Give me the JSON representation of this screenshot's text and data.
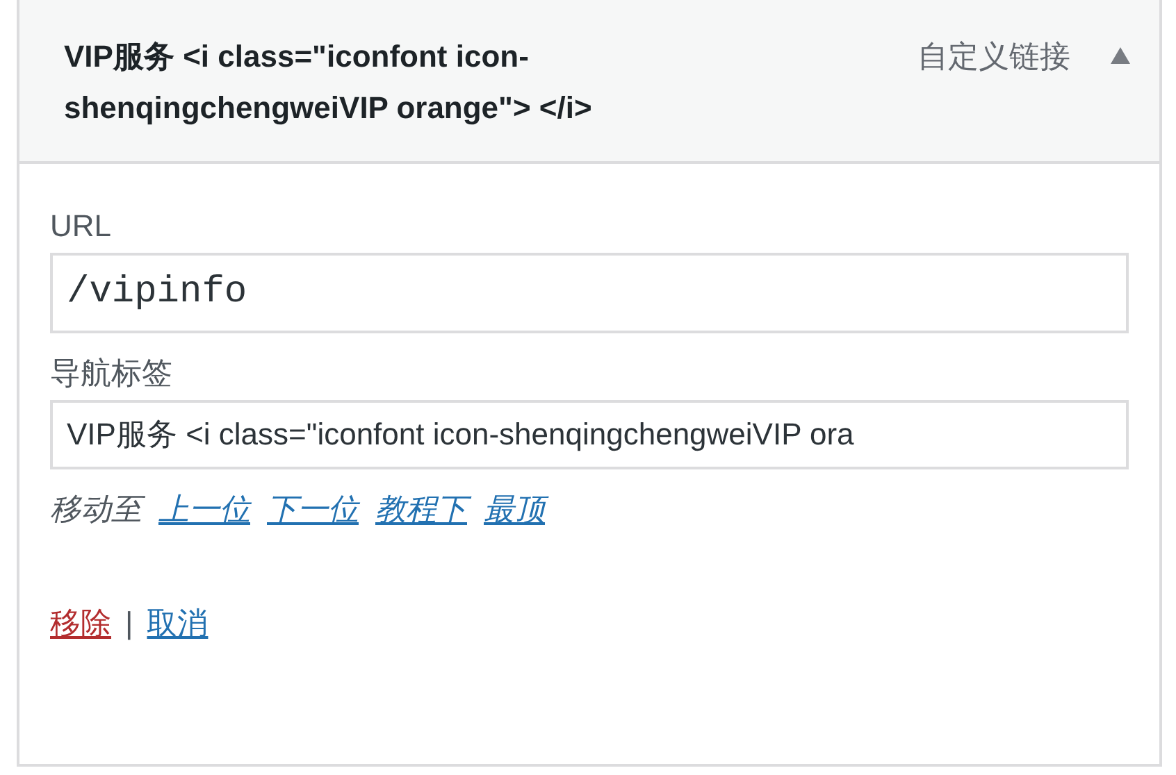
{
  "header": {
    "title": "VIP服务 <i class=\"iconfont icon-shenqingchengweiVIP orange\"> </i>",
    "type_label": "自定义链接",
    "expanded": true
  },
  "fields": [
    {
      "label": "URL",
      "value": "/vipinfo",
      "kind": "mono"
    },
    {
      "label": "导航标签",
      "value": "VIP服务 <i class=\"iconfont icon-shenqingchengweiVIP ora",
      "kind": "text"
    }
  ],
  "move": {
    "label": "移动至",
    "links": [
      "上一位",
      "下一位",
      "教程下",
      "最顶"
    ]
  },
  "actions": [
    {
      "label": "移除",
      "kind": "delete"
    },
    {
      "label": "|",
      "kind": "separator"
    },
    {
      "label": "取消",
      "kind": "cancel"
    }
  ]
}
